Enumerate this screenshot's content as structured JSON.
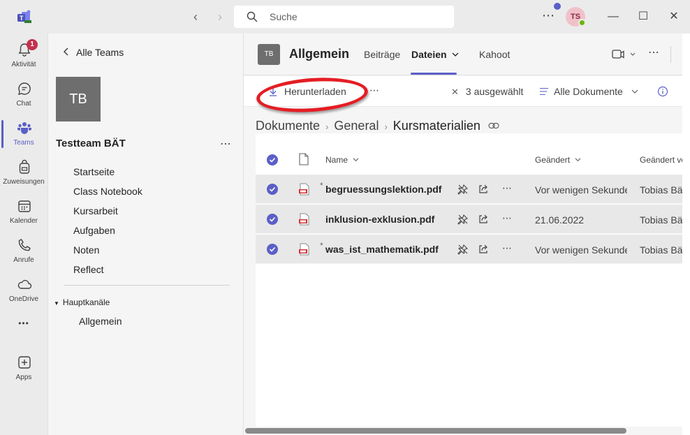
{
  "titlebar": {
    "search_placeholder": "Suche",
    "avatar_initials": "TS",
    "more": "⋯",
    "minimize": "—",
    "maximize": "☐",
    "close": "✕",
    "back": "‹",
    "forward": "›"
  },
  "rail": {
    "items": [
      {
        "label": "Aktivität",
        "icon": "bell-icon",
        "badge": "1"
      },
      {
        "label": "Chat",
        "icon": "chat-icon"
      },
      {
        "label": "Teams",
        "icon": "teams-icon",
        "active": true
      },
      {
        "label": "Zuweisungen",
        "icon": "backpack-icon"
      },
      {
        "label": "Kalender",
        "icon": "calendar-icon"
      },
      {
        "label": "Anrufe",
        "icon": "phone-icon"
      },
      {
        "label": "OneDrive",
        "icon": "cloud-icon"
      },
      {
        "label": "Apps",
        "icon": "add-app-icon"
      }
    ],
    "more": "•••"
  },
  "teampanel": {
    "back_label": "Alle Teams",
    "team_initials": "TB",
    "team_name": "Testteam BÄT",
    "team_more": "⋯",
    "nav": [
      "Startseite",
      "Class Notebook",
      "Kursarbeit",
      "Aufgaben",
      "Noten",
      "Reflect"
    ],
    "channels_heading": "Hauptkanäle",
    "channel": "Allgemein"
  },
  "channel": {
    "tile_initials": "TB",
    "title": "Allgemein",
    "tabs": [
      "Beiträge",
      "Dateien",
      "Kahoot"
    ],
    "active_tab": "Dateien",
    "more": "⋯"
  },
  "commandbar": {
    "download_label": "Herunterladen",
    "more": "⋯",
    "selected_count_label": "3 ausgewählt",
    "view_label": "Alle Dokumente"
  },
  "breadcrumb": [
    "Dokumente",
    "General",
    "Kursmaterialien"
  ],
  "files": {
    "columns": {
      "name": "Name",
      "modified": "Geändert",
      "modified_by": "Geändert von"
    },
    "rows": [
      {
        "name": "begruessungslektion.pdf",
        "modified": "Vor wenigen Sekunden",
        "modified_by": "Tobias Bäuerle",
        "new": true
      },
      {
        "name": "inklusion-exklusion.pdf",
        "modified": "21.06.2022",
        "modified_by": "Tobias Bäuerle",
        "new": false
      },
      {
        "name": "was_ist_mathematik.pdf",
        "modified": "Vor wenigen Sekunden",
        "modified_by": "Tobias Bäuerle",
        "new": true
      }
    ]
  },
  "colors": {
    "accent": "#5b5fc7",
    "highlight_ring": "#e31e24",
    "badge": "#c4314b"
  }
}
